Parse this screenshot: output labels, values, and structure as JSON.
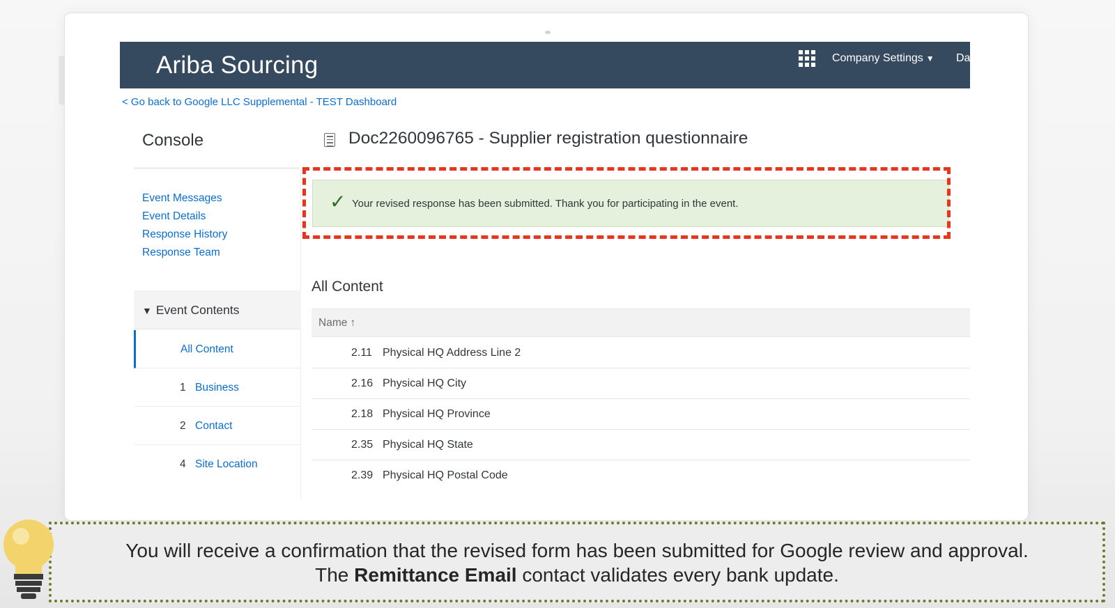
{
  "app": {
    "title": "Ariba Sourcing"
  },
  "header": {
    "company_settings": "Company Settings",
    "user_menu": "Da"
  },
  "back_link": "< Go back to Google LLC Supplemental - TEST Dashboard",
  "console": {
    "title": "Console",
    "links": [
      "Event Messages",
      "Event Details",
      "Response History",
      "Response Team"
    ],
    "event_contents_label": "Event Contents",
    "nav": {
      "all_content": "All Content",
      "items": [
        {
          "num": "1",
          "label": "Business"
        },
        {
          "num": "2",
          "label": "Contact"
        },
        {
          "num": "4",
          "label": "Site Location"
        }
      ]
    }
  },
  "document": {
    "title": "Doc2260096765 - Supplier registration questionnaire"
  },
  "message": {
    "text": "Your revised response has been submitted.  Thank you for participating in the event."
  },
  "content": {
    "title": "All Content",
    "column_name": "Name",
    "rows": [
      {
        "num": "2.11",
        "name": "Physical HQ Address Line 2"
      },
      {
        "num": "2.16",
        "name": "Physical HQ City"
      },
      {
        "num": "2.18",
        "name": "Physical HQ Province"
      },
      {
        "num": "2.35",
        "name": "Physical HQ State"
      },
      {
        "num": "2.39",
        "name": "Physical HQ Postal Code"
      }
    ]
  },
  "caption": {
    "line1": "You will receive a confirmation that the revised form has been submitted for Google review and approval.",
    "line2_prefix": "The",
    "line2_bold": "Remittance Email",
    "line2_suffix": "contact validates every bank update."
  },
  "icons": {
    "apps": "apps-grid-icon",
    "caret": "caret-down-icon",
    "triangle": "triangle-down-icon",
    "check": "checkmark-icon",
    "sort": "sort-ascending-icon",
    "doc": "document-icon",
    "bulb": "lightbulb-icon"
  },
  "colors": {
    "topbar": "#354a5f",
    "link": "#0a6ed1",
    "highlight": "#e8351e",
    "success_bg": "#e5f0dd",
    "caption_border": "#6e7b2b",
    "bulb": "#f3d36b"
  }
}
